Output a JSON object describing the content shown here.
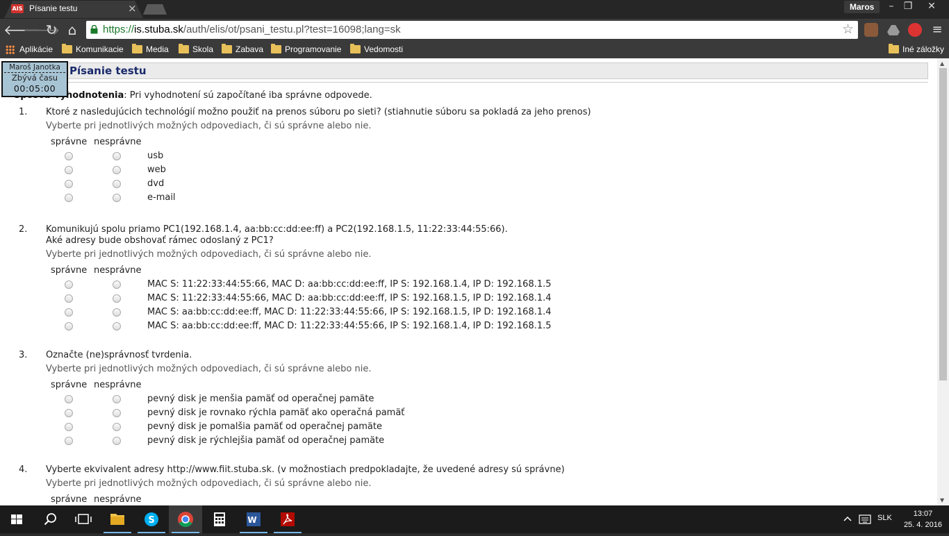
{
  "browser": {
    "tab_title": "Písanie testu",
    "tab_favicon": "AIS",
    "profile_name": "Maros",
    "url_scheme": "https://",
    "url_host": "is.stuba.sk",
    "url_path": "/auth/elis/ot/psani_testu.pl?test=16098;lang=sk",
    "bookmarks": [
      "Aplikácie",
      "Komunikacie",
      "Media",
      "Skola",
      "Zabava",
      "Programovanie",
      "Vedomosti"
    ],
    "other_bookmarks": "Iné záložky"
  },
  "page": {
    "title": "Písanie testu",
    "timer": {
      "user": "Maroš Janotka",
      "label": "Zbývá času",
      "time": "00:05:00"
    },
    "eval_label": "Spôsob vyhodnotenia",
    "eval_text": ": Pri vyhodnotení sú započítané iba správne odpovede.",
    "col_correct": "správne",
    "col_incorrect": "nesprávne",
    "hint": "Vyberte pri jednotlivých možných odpovediach, či sú správne alebo nie.",
    "questions": [
      {
        "num": "1.",
        "text": "Ktoré z nasledujúcich technológií možno použiť na prenos súboru po sieti? (stiahnutie súboru sa pokladá za jeho prenos)",
        "text2": "",
        "options": [
          "usb",
          "web",
          "dvd",
          "e-mail"
        ]
      },
      {
        "num": "2.",
        "text": "Komunikujú spolu priamo PC1(192.168.1.4, aa:bb:cc:dd:ee:ff) a PC2(192.168.1.5, 11:22:33:44:55:66).",
        "text2": "Aké adresy bude obshovať rámec odoslaný z PC1?",
        "options": [
          "MAC S: 11:22:33:44:55:66, MAC D: aa:bb:cc:dd:ee:ff, IP S: 192.168.1.4, IP D: 192.168.1.5",
          "MAC S: 11:22:33:44:55:66, MAC D: aa:bb:cc:dd:ee:ff, IP S: 192.168.1.5, IP D: 192.168.1.4",
          "MAC S: aa:bb:cc:dd:ee:ff, MAC D: 11:22:33:44:55:66, IP S: 192.168.1.5, IP D: 192.168.1.4",
          "MAC S: aa:bb:cc:dd:ee:ff, MAC D: 11:22:33:44:55:66, IP S: 192.168.1.4, IP D: 192.168.1.5"
        ]
      },
      {
        "num": "3.",
        "text": "Označte (ne)správnosť tvrdenia.",
        "text2": "",
        "options": [
          "pevný disk je menšia pamäť od operačnej pamäte",
          "pevný disk je rovnako rýchla pamäť ako operačná pamäť",
          "pevný disk je pomalšia pamäť od operačnej pamäte",
          "pevný disk je rýchlejšia pamäť od operačnej pamäte"
        ]
      },
      {
        "num": "4.",
        "text": "Vyberte ekvivalent adresy http://www.fiit.stuba.sk. (v možnostiach predpokladajte, že uvedené adresy sú správne)",
        "text2": "",
        "options": []
      }
    ]
  },
  "taskbar": {
    "language": "SLK",
    "time": "13:07",
    "date": "25. 4. 2016"
  }
}
